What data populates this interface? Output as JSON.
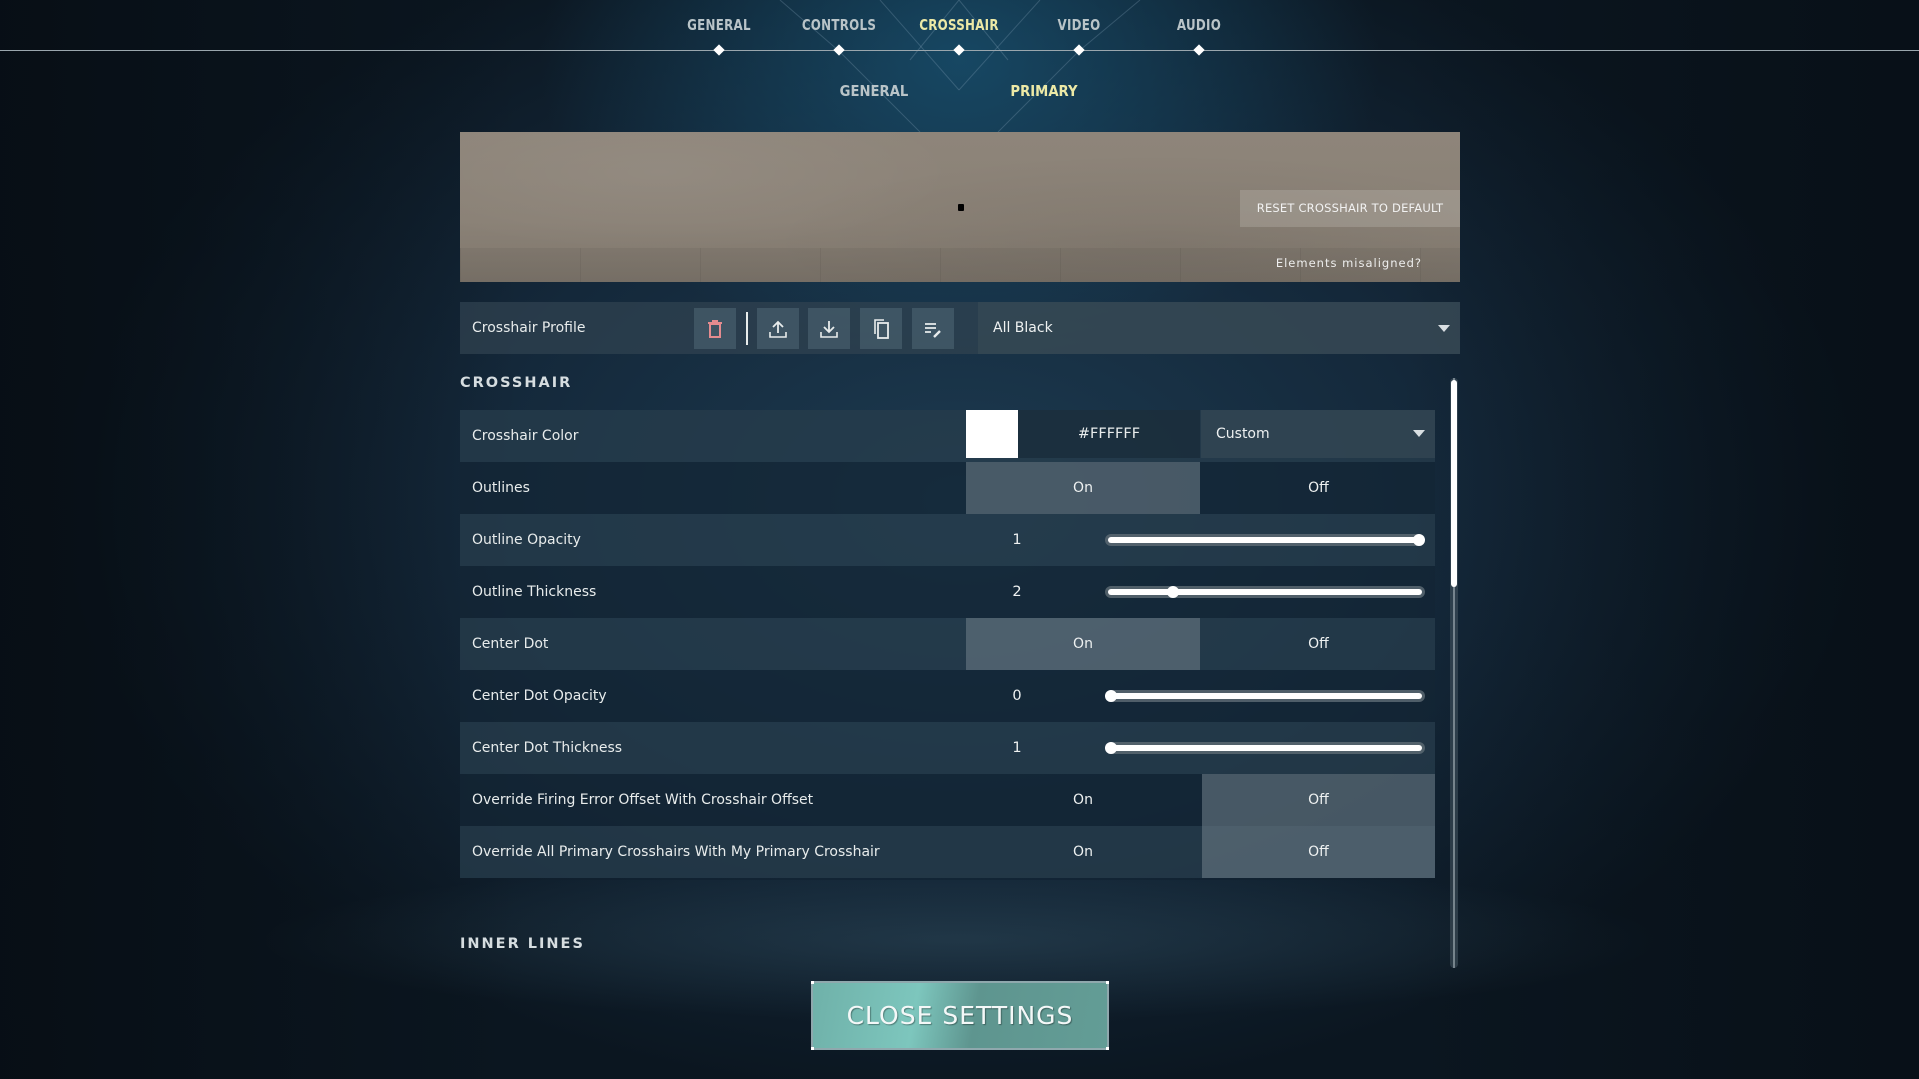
{
  "top_nav": {
    "tabs": [
      {
        "label": "GENERAL",
        "active": false
      },
      {
        "label": "CONTROLS",
        "active": false
      },
      {
        "label": "CROSSHAIR",
        "active": true
      },
      {
        "label": "VIDEO",
        "active": false
      },
      {
        "label": "AUDIO",
        "active": false
      }
    ],
    "sub_tabs": [
      {
        "label": "GENERAL",
        "active": false
      },
      {
        "label": "PRIMARY",
        "active": true
      }
    ],
    "active_color": "#ECE9A6"
  },
  "preview": {
    "reset_label": "RESET CROSSHAIR TO DEFAULT",
    "misaligned_label": "Elements misaligned?"
  },
  "profile": {
    "label": "Crosshair Profile",
    "icons": [
      "trash-icon",
      "upload-icon",
      "download-icon",
      "copy-icon",
      "rename-icon"
    ],
    "selected": "All Black"
  },
  "sections": {
    "crosshair": "CROSSHAIR",
    "inner_lines": "INNER LINES"
  },
  "settings": {
    "crosshair_color": {
      "label": "Crosshair Color",
      "hex": "#FFFFFF",
      "preset": "Custom"
    },
    "outlines": {
      "label": "Outlines",
      "on": "On",
      "off": "Off",
      "value": "On"
    },
    "outline_opacity": {
      "label": "Outline Opacity",
      "value": "1",
      "fraction": 1.0
    },
    "outline_thickness": {
      "label": "Outline Thickness",
      "value": "2",
      "fraction": 0.2
    },
    "center_dot": {
      "label": "Center Dot",
      "on": "On",
      "off": "Off",
      "value": "On"
    },
    "center_dot_opacity": {
      "label": "Center Dot Opacity",
      "value": "0",
      "fraction": 0.0
    },
    "center_dot_thickness": {
      "label": "Center Dot Thickness",
      "value": "1",
      "fraction": 0.0
    },
    "override_firing_error": {
      "label": "Override Firing Error Offset With Crosshair Offset",
      "on": "On",
      "off": "Off",
      "value": "Off"
    },
    "override_all_primary": {
      "label": "Override All Primary Crosshairs With My Primary Crosshair",
      "on": "On",
      "off": "Off",
      "value": "Off"
    }
  },
  "scroll": {
    "position_fraction": 0.0,
    "visible_fraction": 0.35
  },
  "close_button": {
    "label": "CLOSE SETTINGS"
  }
}
